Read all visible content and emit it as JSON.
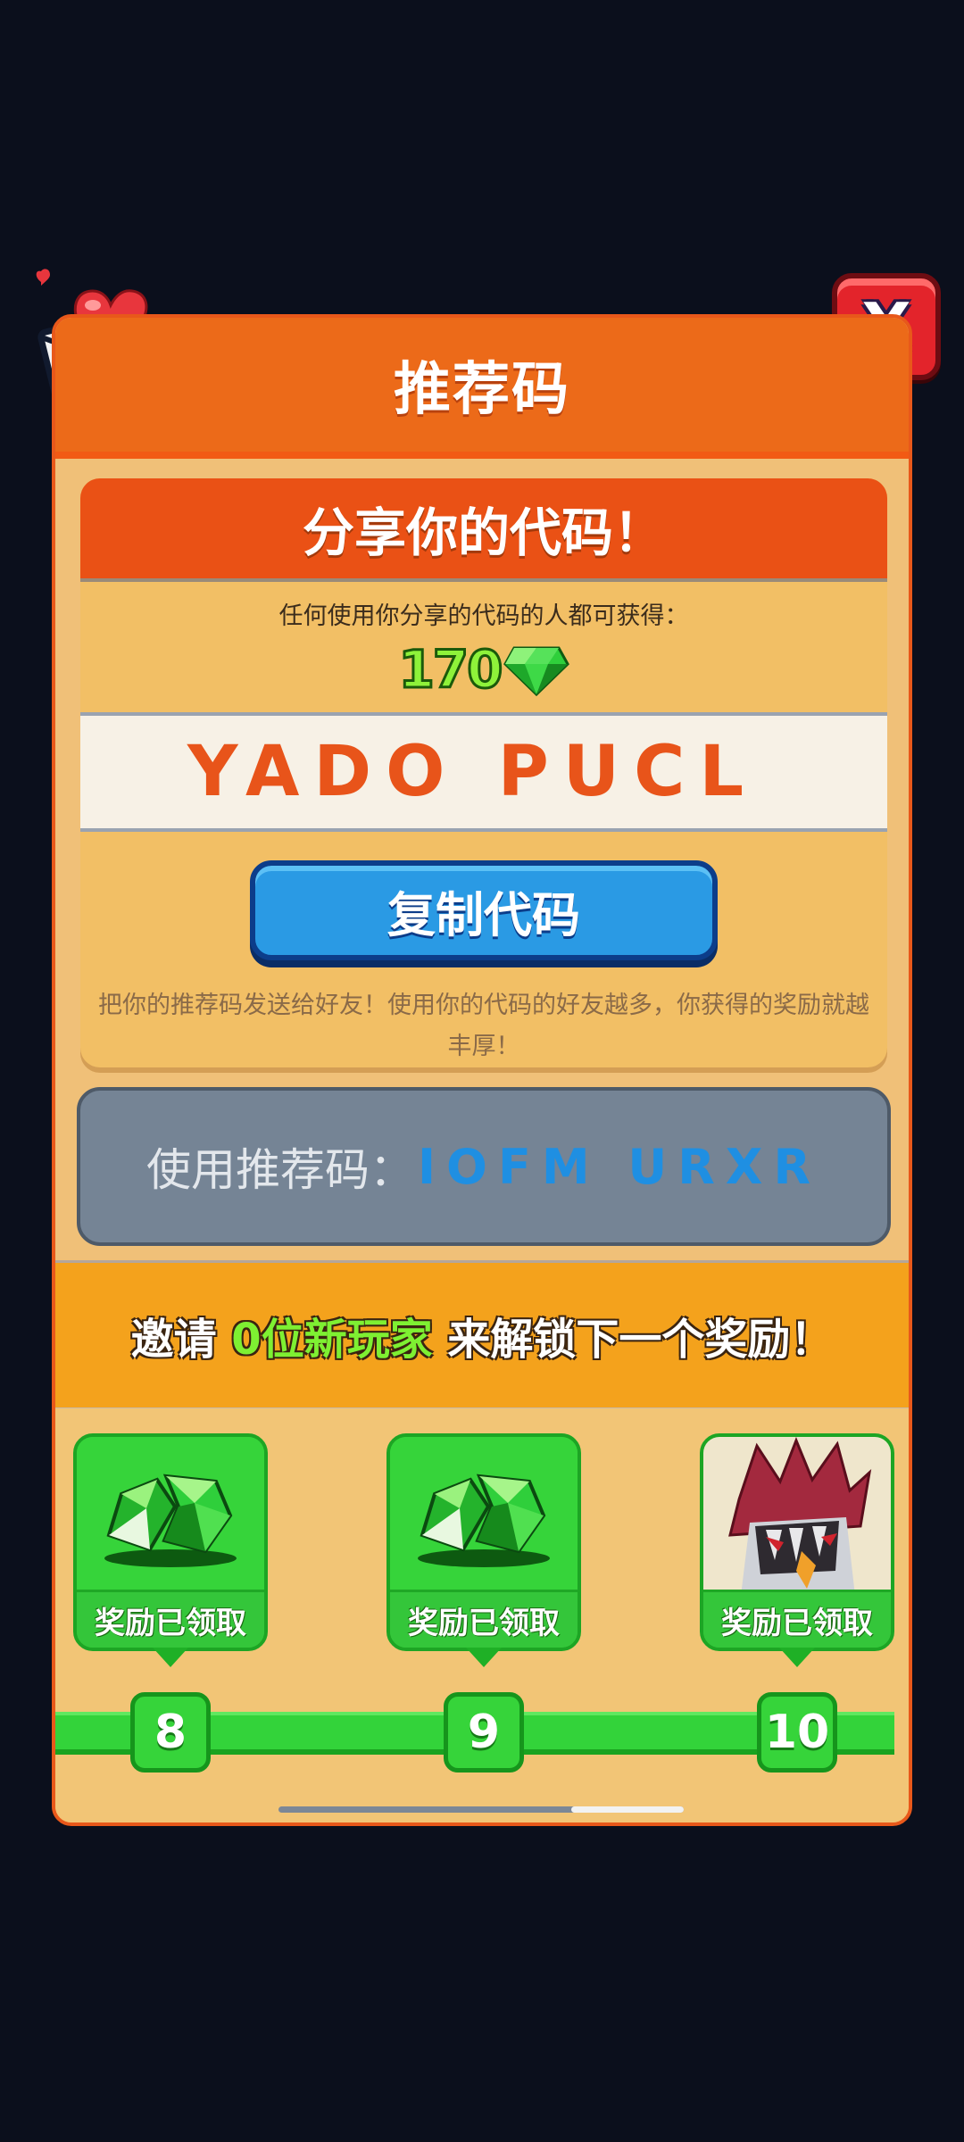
{
  "header": {
    "title": "推荐码",
    "close_label": "X"
  },
  "share": {
    "title": "分享你的代码！",
    "description": "任何使用你分享的代码的人都可获得：",
    "reward_amount": "170",
    "reward_icon": "gem-icon",
    "code": "YADO PUCL",
    "copy_button": "复制代码",
    "hint": "把你的推荐码发送给好友！使用你的代码的好友越多，你获得的奖励就越丰厚！"
  },
  "use_code": {
    "label": "使用推荐码：",
    "value": "IOFM URXR"
  },
  "invite": {
    "prefix": "邀请 ",
    "count": "0",
    "highlight": "位新玩家",
    "suffix": " 来解锁下一个奖励！"
  },
  "rewards": [
    {
      "label": "奖励已领取",
      "level": "8",
      "icon": "gem-pile-icon"
    },
    {
      "label": "奖励已领取",
      "level": "9",
      "icon": "gem-pile-icon"
    },
    {
      "label": "奖励已领取",
      "level": "10",
      "icon": "character-icon"
    }
  ],
  "colors": {
    "header": "#ec6a19",
    "accent_green": "#36d43a",
    "code_orange": "#e8541a",
    "use_code_blue": "#1f8fe2",
    "copy_button_blue": "#2a9ae4",
    "close_red": "#e3242b"
  }
}
